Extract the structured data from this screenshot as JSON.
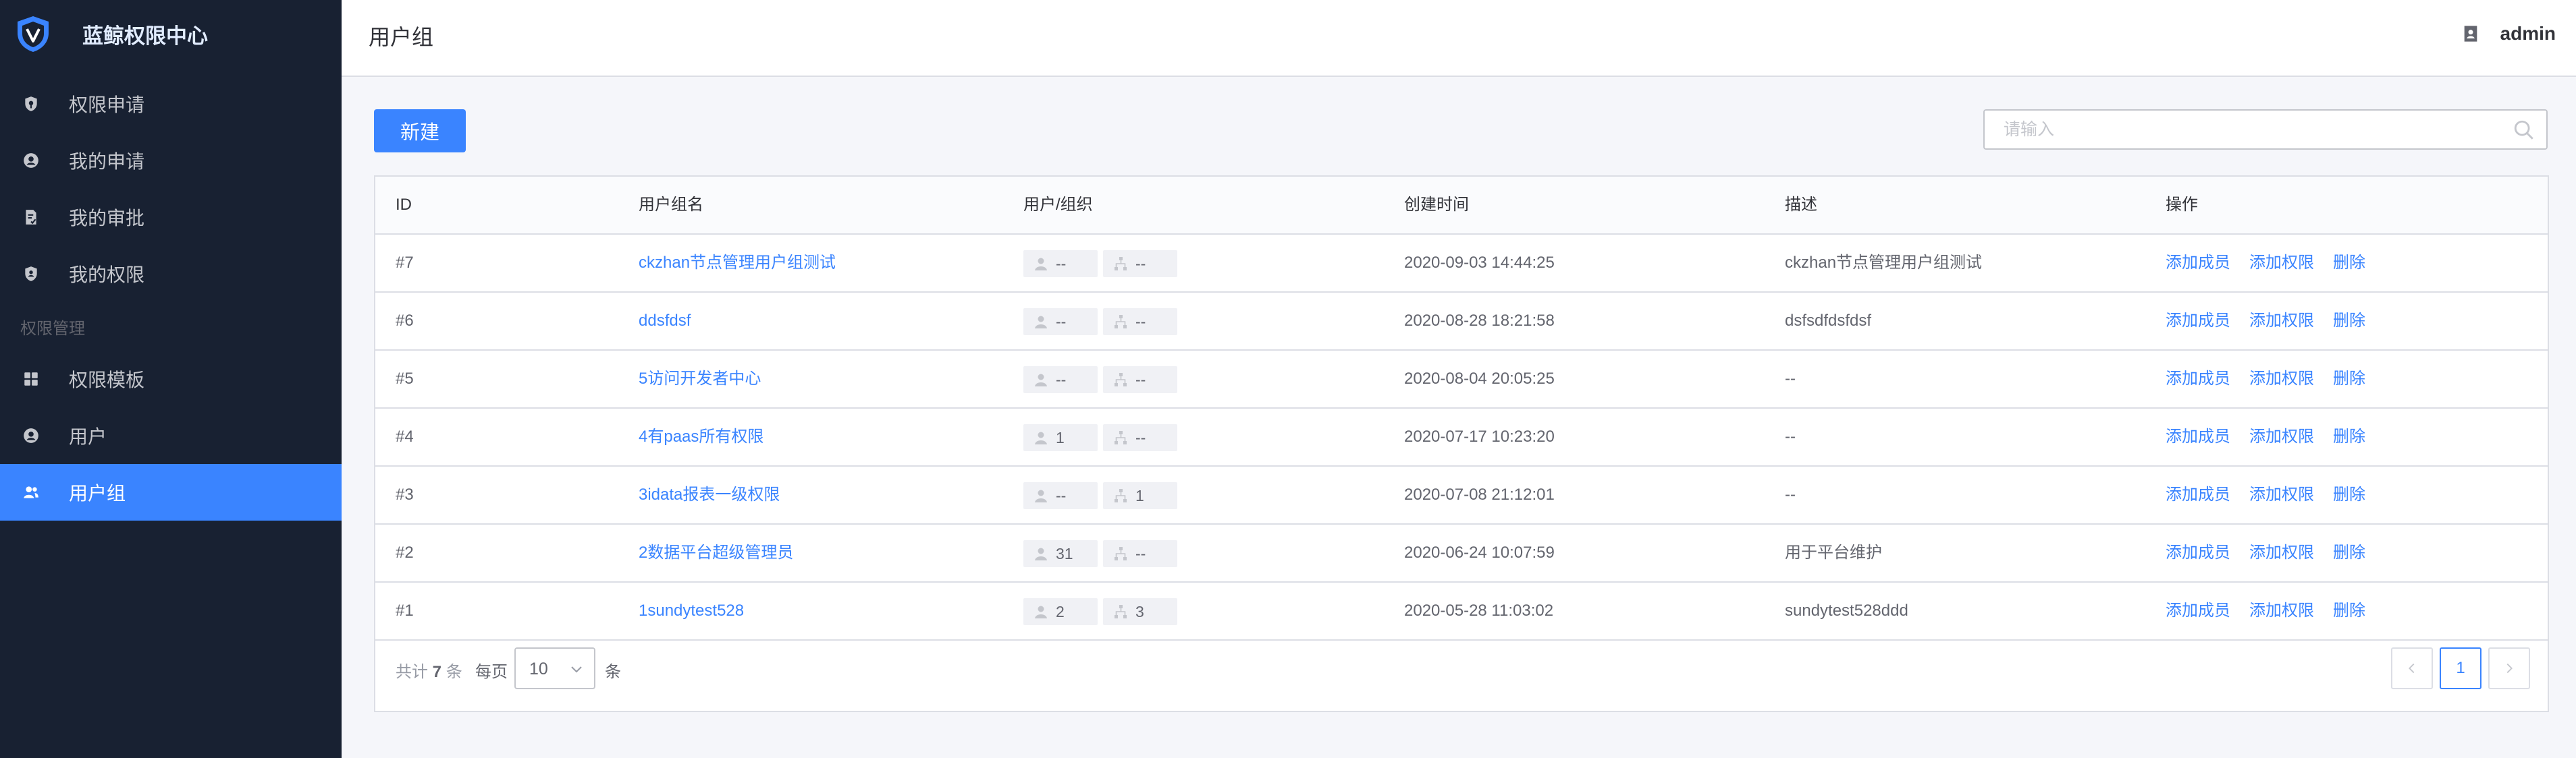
{
  "app": {
    "title": "蓝鲸权限中心"
  },
  "nav": {
    "items": [
      {
        "label": "权限申请",
        "icon": "shield-key-icon"
      },
      {
        "label": "我的申请",
        "icon": "user-circle-icon"
      },
      {
        "label": "我的审批",
        "icon": "document-check-icon"
      },
      {
        "label": "我的权限",
        "icon": "shield-user-icon"
      }
    ],
    "group_label": "权限管理",
    "admin_items": [
      {
        "label": "权限模板",
        "icon": "grid-icon"
      },
      {
        "label": "用户",
        "icon": "user-circle-icon"
      },
      {
        "label": "用户组",
        "icon": "users-icon",
        "active": true
      }
    ]
  },
  "header": {
    "title": "用户组",
    "user": "admin"
  },
  "toolbar": {
    "new_label": "新建",
    "search_placeholder": "请输入"
  },
  "table": {
    "headers": [
      "ID",
      "用户组名",
      "用户/组织",
      "创建时间",
      "描述",
      "操作"
    ],
    "rows": [
      {
        "id": "#7",
        "name": "ckzhan节点管理用户组测试",
        "users": "--",
        "orgs": "--",
        "created": "2020-09-03 14:44:25",
        "desc": "ckzhan节点管理用户组测试"
      },
      {
        "id": "#6",
        "name": "ddsfdsf",
        "users": "--",
        "orgs": "--",
        "created": "2020-08-28 18:21:58",
        "desc": "dsfsdfdsfdsf"
      },
      {
        "id": "#5",
        "name": "5访问开发者中心",
        "users": "--",
        "orgs": "--",
        "created": "2020-08-04 20:05:25",
        "desc": "--"
      },
      {
        "id": "#4",
        "name": "4有paas所有权限",
        "users": "1",
        "orgs": "--",
        "created": "2020-07-17 10:23:20",
        "desc": "--"
      },
      {
        "id": "#3",
        "name": "3idata报表一级权限",
        "users": "--",
        "orgs": "1",
        "created": "2020-07-08 21:12:01",
        "desc": "--"
      },
      {
        "id": "#2",
        "name": "2数据平台超级管理员",
        "users": "31",
        "orgs": "--",
        "created": "2020-06-24 10:07:59",
        "desc": "用于平台维护"
      },
      {
        "id": "#1",
        "name": "1sundytest528",
        "users": "2",
        "orgs": "3",
        "created": "2020-05-28 11:03:02",
        "desc": "sundytest528ddd"
      }
    ],
    "actions": [
      "添加成员",
      "添加权限",
      "删除"
    ]
  },
  "pagination": {
    "total_prefix": "共计",
    "total": "7",
    "total_suffix": "条",
    "per_page_label": "每页",
    "page_size": "10",
    "per_page_unit": "条",
    "current_page": "1"
  },
  "colors": {
    "primary": "#3a84ff",
    "sidebar": "#182132"
  }
}
